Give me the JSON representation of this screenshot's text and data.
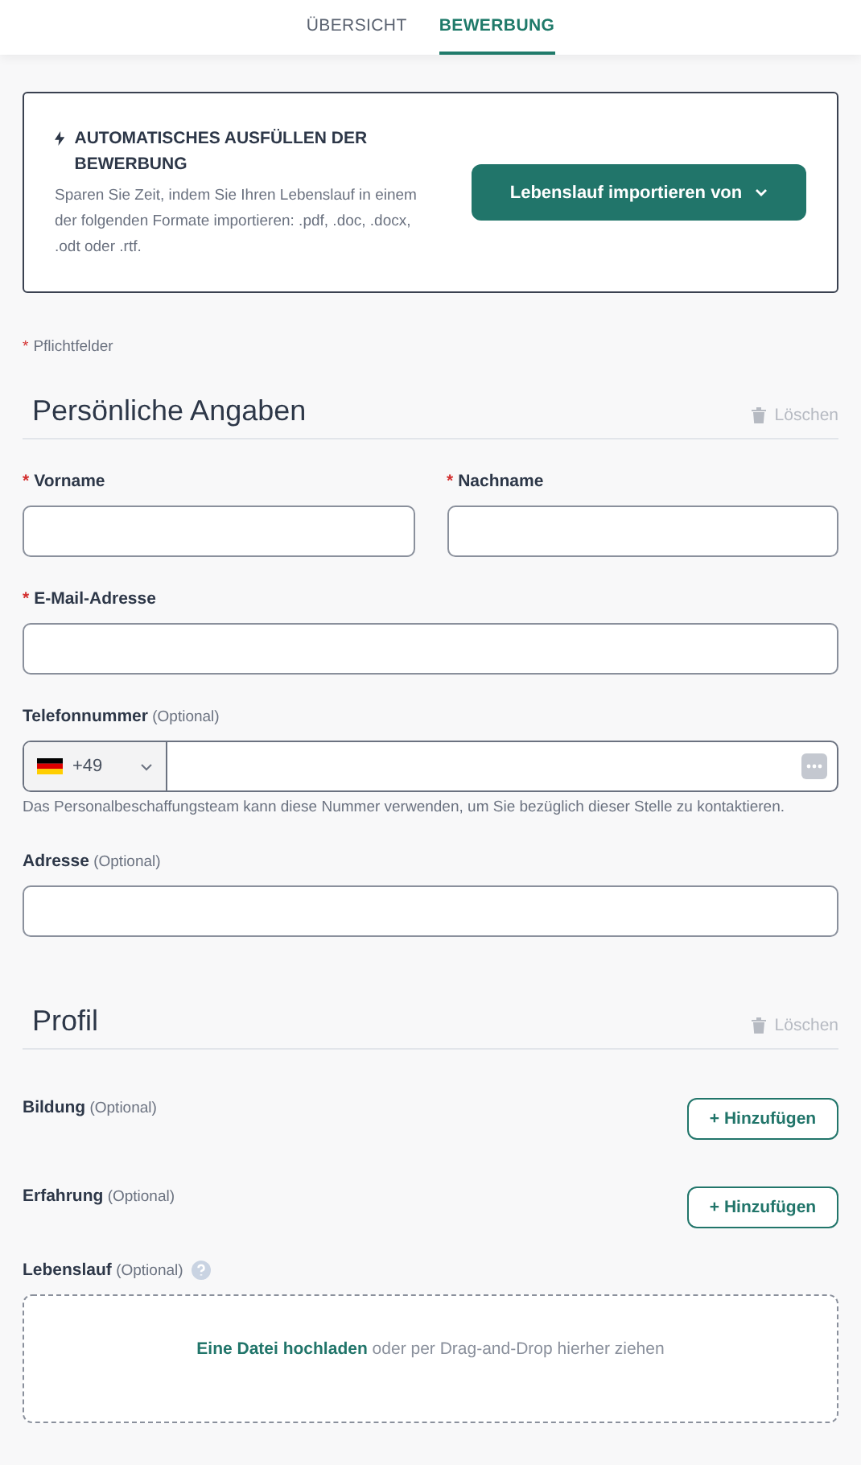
{
  "tabs": [
    {
      "label": "ÜBERSICHT",
      "selected": false
    },
    {
      "label": "BEWERBUNG",
      "selected": true
    }
  ],
  "autofill": {
    "title": "AUTOMATISCHES AUSFÜLLEN DER BEWERBUNG",
    "description": "Sparen Sie Zeit, indem Sie Ihren Lebenslauf in einem der folgenden Formate importieren: .pdf, .doc, .docx, .odt oder .rtf.",
    "button": "Lebenslauf importieren von"
  },
  "required_note": {
    "mark": "*",
    "text": "Pflichtfelder"
  },
  "sections": [
    {
      "title": "Persönliche Angaben",
      "clear": "Löschen",
      "rows": [
        [
          {
            "kind": "text",
            "label": "Vorname",
            "required": true
          },
          {
            "kind": "text",
            "label": "Nachname",
            "required": true
          }
        ],
        [
          {
            "kind": "text",
            "label": "E-Mail-Adresse",
            "required": true
          }
        ],
        [
          {
            "kind": "phone",
            "label": "Telefonnummer",
            "optional": "(Optional)",
            "required": false,
            "country_code": "+49",
            "help": "Das Personalbeschaffungsteam kann diese Nummer verwenden, um Sie bezüglich dieser Stelle zu kontaktieren."
          }
        ],
        [
          {
            "kind": "text",
            "label": "Adresse",
            "optional": "(Optional)",
            "required": false
          }
        ]
      ]
    },
    {
      "title": "Profil",
      "clear": "Löschen",
      "rows": [
        [
          {
            "kind": "add",
            "label": "Bildung",
            "optional": "(Optional)",
            "required": false,
            "button": "+ Hinzufügen"
          }
        ],
        [
          {
            "kind": "add",
            "label": "Erfahrung",
            "optional": "(Optional)",
            "required": false,
            "button": "+ Hinzufügen"
          }
        ],
        [
          {
            "kind": "upload",
            "label": "Lebenslauf",
            "optional": "(Optional)",
            "required": false,
            "link": "Eine Datei hochladen",
            "rest": "oder per Drag-and-Drop hierher ziehen"
          }
        ]
      ]
    }
  ]
}
